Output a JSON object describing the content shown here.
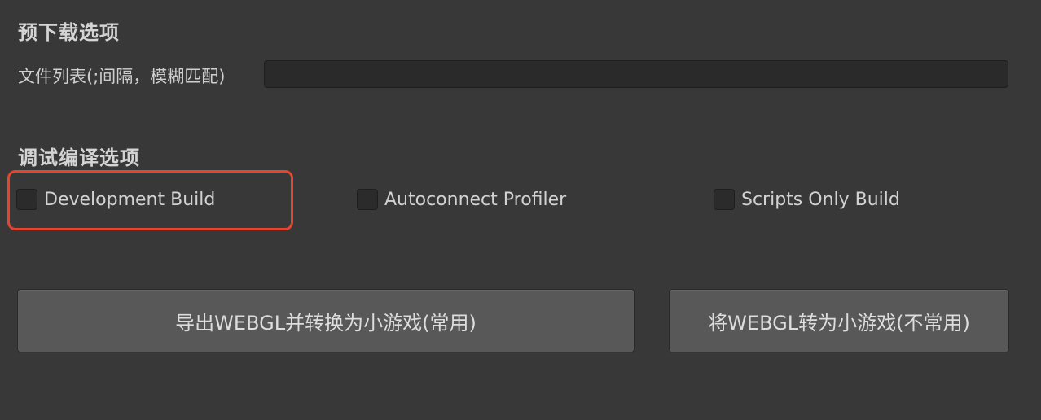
{
  "preload": {
    "section_title": "预下载选项",
    "file_list_label": "文件列表(;间隔，模糊匹配)",
    "file_list_value": ""
  },
  "debug": {
    "section_title": "调试编译选项",
    "toggles": [
      {
        "label": "Development Build",
        "checked": false
      },
      {
        "label": "Autoconnect Profiler",
        "checked": false
      },
      {
        "label": "Scripts Only Build",
        "checked": false
      }
    ]
  },
  "actions": {
    "export_label": "导出WEBGL并转换为小游戏(常用)",
    "convert_label": "将WEBGL转为小游戏(不常用)"
  },
  "colors": {
    "background": "#383838",
    "highlight": "#e5452f",
    "button": "#585858"
  }
}
